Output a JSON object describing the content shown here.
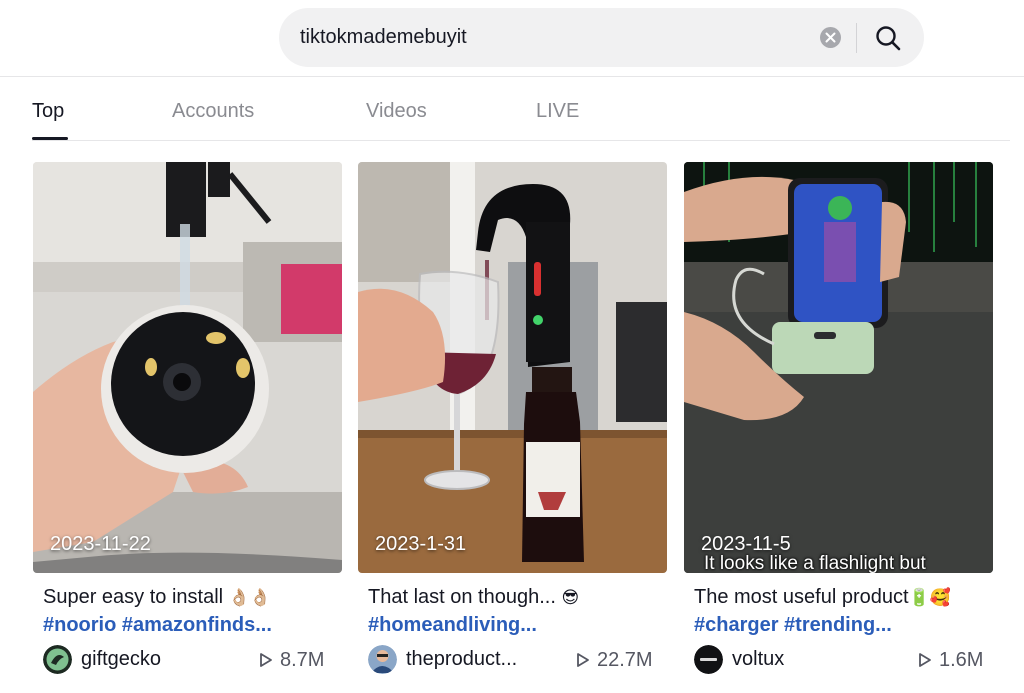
{
  "search": {
    "query": "tiktokmademebuyit"
  },
  "tabs": [
    {
      "label": "Top",
      "active": true
    },
    {
      "label": "Accounts",
      "active": false
    },
    {
      "label": "Videos",
      "active": false
    },
    {
      "label": "LIVE",
      "active": false
    }
  ],
  "results": [
    {
      "date": "2023-11-22",
      "title": "Super easy to install",
      "title_emoji": "👌🏼👌🏼",
      "hashtags": "#noorio #amazonfinds...",
      "author": "giftgecko",
      "views": "8.7M",
      "overlay_caption": ""
    },
    {
      "date": "2023-1-31",
      "title": "That last on though...",
      "title_emoji": "😎",
      "hashtags": "#homeandliving...",
      "author": "theproduct...",
      "views": "22.7M",
      "overlay_caption": ""
    },
    {
      "date": "2023-11-5",
      "title": "The most useful product",
      "title_emoji": "🔋🥰",
      "hashtags": "#charger #trending...",
      "author": "voltux",
      "views": "1.6M",
      "overlay_caption": "It looks like a flashlight but"
    }
  ],
  "icons": {
    "clear": "clear-icon",
    "search": "search-icon",
    "play": "play-icon"
  },
  "colors": {
    "hashtag": "#2b5db9",
    "text": "#161823",
    "muted": "#8a8b91",
    "search_bg": "#f1f1f2"
  }
}
